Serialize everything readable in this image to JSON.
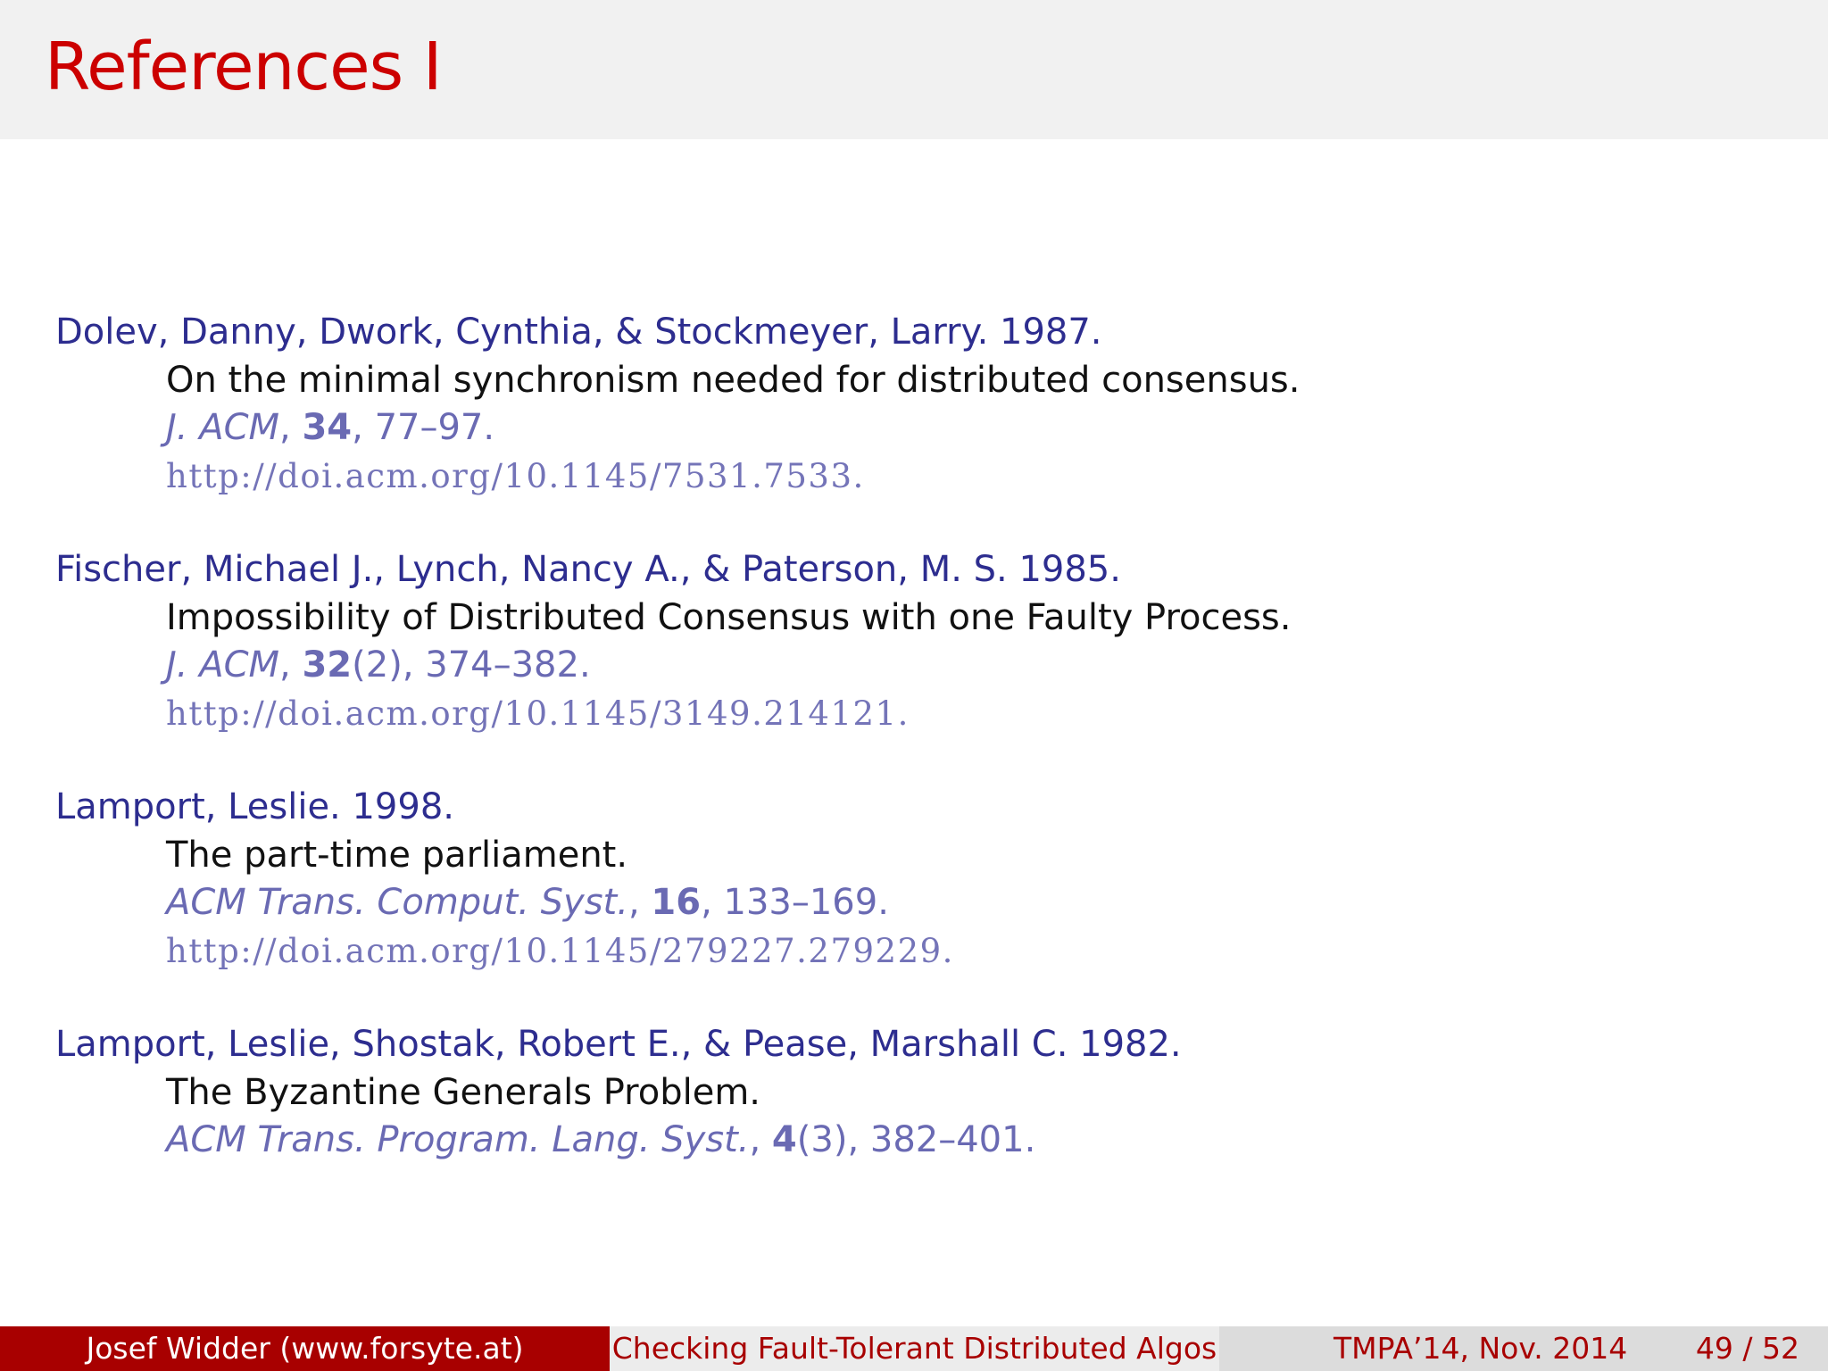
{
  "slide": {
    "title": "References I"
  },
  "references": [
    {
      "authors": "Dolev, Danny, Dwork, Cynthia, & Stockmeyer, Larry. 1987.",
      "title": "On the minimal synchronism needed for distributed consensus.",
      "journal": "J. ACM",
      "volume": "34",
      "issue": "",
      "pages": ", 77–97.",
      "url": "http://doi.acm.org/10.1145/7531.7533."
    },
    {
      "authors": "Fischer, Michael J., Lynch, Nancy A., & Paterson, M. S. 1985.",
      "title": "Impossibility of Distributed Consensus with one Faulty Process.",
      "journal": "J. ACM",
      "volume": "32",
      "issue": "(2)",
      "pages": ", 374–382.",
      "url": "http://doi.acm.org/10.1145/3149.214121."
    },
    {
      "authors": "Lamport, Leslie. 1998.",
      "title": "The part-time parliament.",
      "journal": "ACM Trans. Comput. Syst.",
      "volume": "16",
      "issue": "",
      "pages": ", 133–169.",
      "url": "http://doi.acm.org/10.1145/279227.279229."
    },
    {
      "authors": "Lamport, Leslie, Shostak, Robert E., & Pease, Marshall C. 1982.",
      "title": "The Byzantine Generals Problem.",
      "journal": "ACM Trans. Program. Lang. Syst.",
      "volume": "4",
      "issue": "(3)",
      "pages": ", 382–401.",
      "url": ""
    }
  ],
  "footer": {
    "author": "Josef Widder  (www.forsyte.at)",
    "talk_title": "Checking Fault-Tolerant Distributed Algos",
    "event": "TMPA’14, Nov. 2014",
    "page": "49 / 52"
  },
  "colors": {
    "title_red": "#cc0000",
    "author_blue": "#2d2d8f",
    "journal_blue": "#6a6ab3",
    "footer_red": "#a80000"
  }
}
